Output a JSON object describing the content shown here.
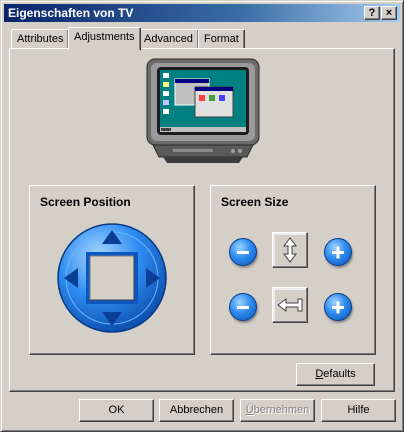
{
  "window": {
    "title": "Eigenschaften von TV"
  },
  "titlebar_buttons": {
    "help": "?",
    "close": "×"
  },
  "tabs": [
    {
      "label": "Attributes",
      "active": false
    },
    {
      "label": "Adjustments",
      "active": true
    },
    {
      "label": "Advanced",
      "active": false
    },
    {
      "label": "Format",
      "active": false
    }
  ],
  "screen_position": {
    "title": "Screen Position"
  },
  "screen_size": {
    "title": "Screen Size"
  },
  "defaults_button": {
    "hotkey": "D",
    "rest": "efaults"
  },
  "footer": {
    "ok": "OK",
    "cancel": "Abbrechen",
    "apply_hotkey": "Ü",
    "apply_rest": "bernehmen",
    "help": "Hilfe"
  },
  "icons": {
    "tv": "tv-monitor-icon",
    "dpad": "direction-pad-icon",
    "minus": "minus-icon",
    "plus": "plus-icon",
    "vertical": "vertical-resize-icon",
    "horizontal": "horizontal-resize-icon"
  },
  "colors": {
    "title_start": "#0a246a",
    "title_end": "#a6caf0",
    "face": "#d4d0c8",
    "accent_blue": "#2f8cf0"
  }
}
